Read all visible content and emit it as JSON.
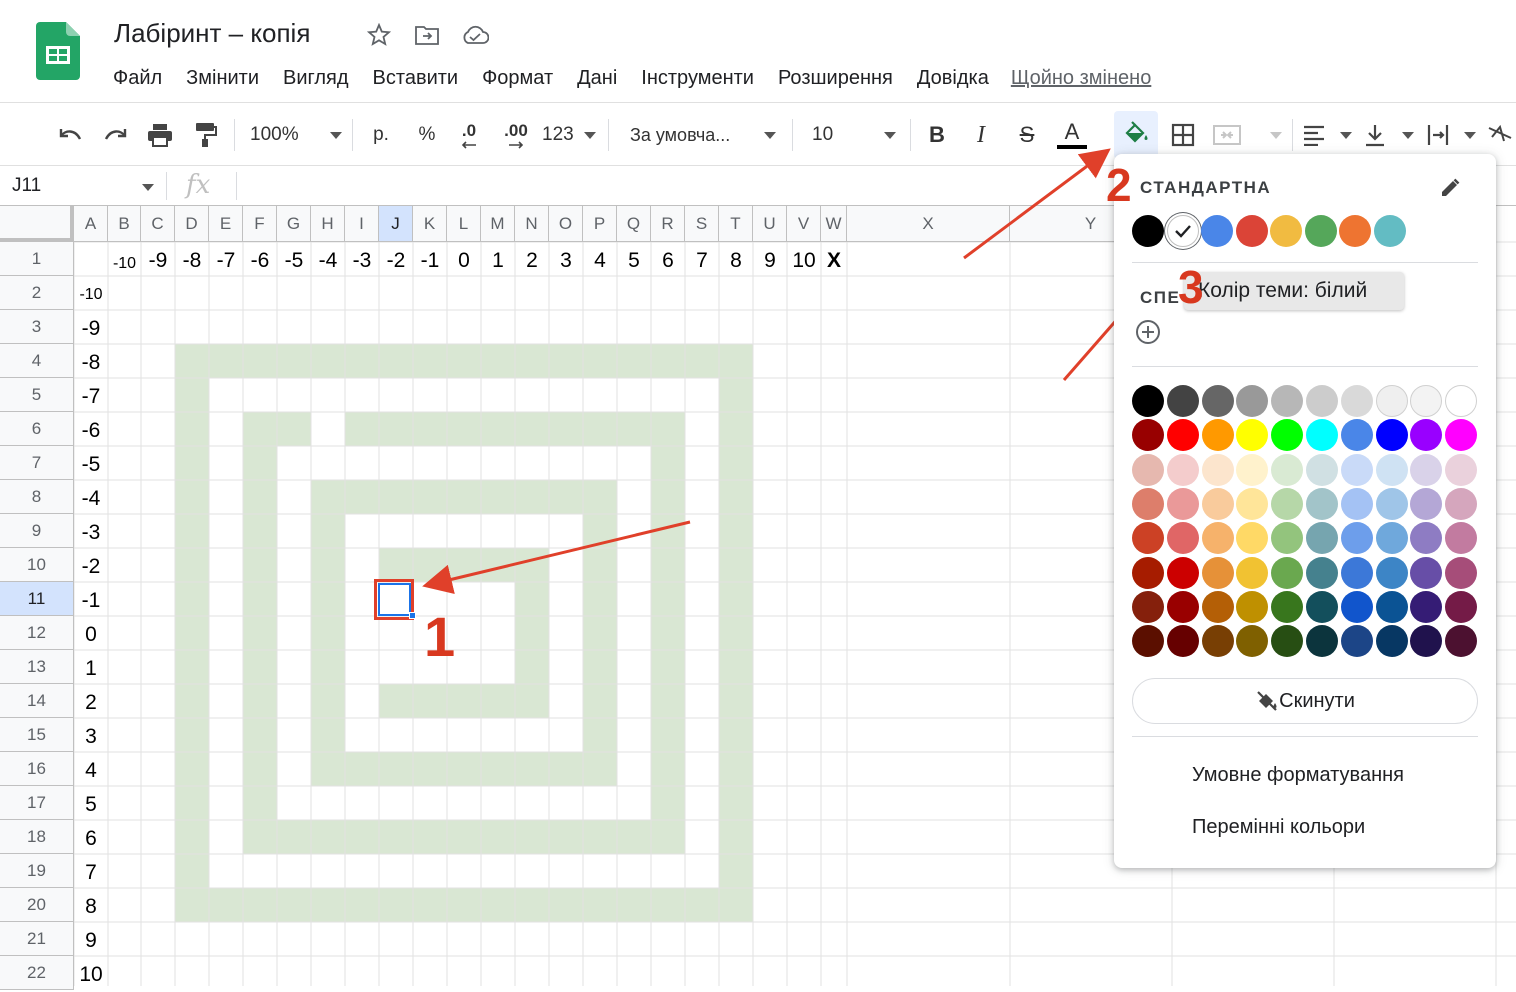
{
  "app": {
    "title": "Лабіринт – копія",
    "last_edit": "Щойно змінено",
    "menus": [
      "Файл",
      "Змінити",
      "Вигляд",
      "Вставити",
      "Формат",
      "Дані",
      "Інструменти",
      "Розширення",
      "Довідка"
    ]
  },
  "toolbar": {
    "zoom": "100%",
    "currency": "р.",
    "percent": "%",
    "decimal_decrease": ".0",
    "decimal_increase": ".00",
    "number_format": "123",
    "font": "За умовча...",
    "font_size": "10",
    "bold": "B",
    "italic": "I",
    "strike": "S",
    "text_color_letter": "A"
  },
  "formula_bar": {
    "cell_ref": "J11",
    "fx": "fx"
  },
  "grid": {
    "columns": [
      "A",
      "B",
      "C",
      "D",
      "E",
      "F",
      "G",
      "H",
      "I",
      "J",
      "K",
      "L",
      "M",
      "N",
      "O",
      "P",
      "Q",
      "R",
      "S",
      "T",
      "U",
      "V",
      "W",
      "X",
      "Y"
    ],
    "rows": [
      "1",
      "2",
      "3",
      "4",
      "5",
      "6",
      "7",
      "8",
      "9",
      "10",
      "11",
      "12",
      "13",
      "14",
      "15",
      "16",
      "17",
      "18",
      "19",
      "20",
      "21",
      "22"
    ],
    "row1_values": [
      "-10",
      "-9",
      "-8",
      "-7",
      "-6",
      "-5",
      "-4",
      "-3",
      "-2",
      "-1",
      "0",
      "1",
      "2",
      "3",
      "4",
      "5",
      "6",
      "7",
      "8",
      "9",
      "10",
      "X"
    ],
    "colA_values": [
      "-10",
      "-9",
      "-8",
      "-7",
      "-6",
      "-5",
      "-4",
      "-3",
      "-2",
      "-1",
      "0",
      "1",
      "2",
      "3",
      "4",
      "5",
      "6",
      "7",
      "8",
      "9",
      "10"
    ],
    "maze_color": "#d9e7d3",
    "selected_cell": "J11"
  },
  "annotations": {
    "step1": "1",
    "step2": "2",
    "step3": "3",
    "color": "#d8381f"
  },
  "color_menu": {
    "standard_label": "СТАНДАРТНА",
    "custom_label": "СПЕ",
    "tooltip": "Колір теми: білий",
    "reset": "Скинути",
    "conditional": "Умовне форматування",
    "alternating": "Перемінні кольори",
    "standard_swatches": [
      "#000000",
      "#ffffff",
      "#4a86e8",
      "#db4437",
      "#f1bb41",
      "#55a75a",
      "#ee7431",
      "#63bcc3"
    ],
    "palette": [
      [
        "#000000",
        "#434343",
        "#666666",
        "#999999",
        "#b7b7b7",
        "#cccccc",
        "#d9d9d9",
        "#efefef",
        "#f3f3f3",
        "#ffffff"
      ],
      [
        "#980000",
        "#ff0000",
        "#ff9900",
        "#ffff00",
        "#00ff00",
        "#00ffff",
        "#4a86e8",
        "#0000ff",
        "#9900ff",
        "#ff00ff"
      ],
      [
        "#e6b8af",
        "#f4cccc",
        "#fce5cd",
        "#fff2cc",
        "#d9ead3",
        "#d0e0e3",
        "#c9daf8",
        "#cfe2f3",
        "#d9d2e9",
        "#ead1dc"
      ],
      [
        "#dd7e6b",
        "#ea9999",
        "#f9cb9c",
        "#ffe599",
        "#b6d7a8",
        "#a2c4c9",
        "#a4c2f4",
        "#9fc5e8",
        "#b4a7d6",
        "#d5a6bd"
      ],
      [
        "#cc4125",
        "#e06666",
        "#f6b26b",
        "#ffd966",
        "#93c47d",
        "#76a5af",
        "#6d9eeb",
        "#6fa8dc",
        "#8e7cc3",
        "#c27ba0"
      ],
      [
        "#a61c00",
        "#cc0000",
        "#e69138",
        "#f1c232",
        "#6aa84f",
        "#45818e",
        "#3c78d8",
        "#3d85c6",
        "#674ea7",
        "#a64d79"
      ],
      [
        "#85200c",
        "#990000",
        "#b45f06",
        "#bf9000",
        "#38761d",
        "#134f5c",
        "#1155cc",
        "#0b5394",
        "#351c75",
        "#741b47"
      ],
      [
        "#5b0f00",
        "#660000",
        "#783f04",
        "#7f6000",
        "#274e13",
        "#0c343d",
        "#1c4587",
        "#073763",
        "#20124d",
        "#4c1130"
      ]
    ]
  }
}
